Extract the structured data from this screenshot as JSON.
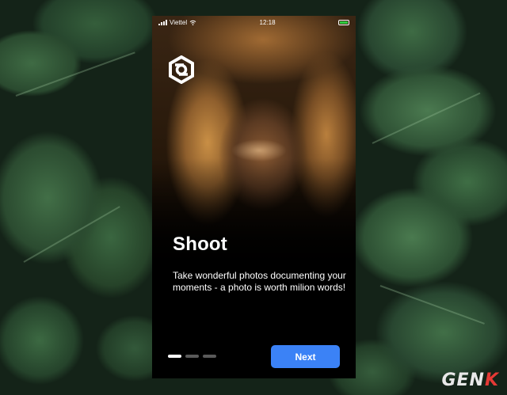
{
  "status_bar": {
    "carrier": "Viettel",
    "time": "12:18"
  },
  "app": {
    "logo_icon": "camera-hexagon-icon"
  },
  "onboarding": {
    "title": "Shoot",
    "description": "Take wonderful photos documenting your moments - a photo is worth milion words!",
    "page_count": 3,
    "current_page": 1,
    "next_label": "Next"
  },
  "watermark": {
    "prefix": "GEN",
    "accent": "K"
  },
  "colors": {
    "button": "#3b82f6",
    "page_dot_active": "#ffffff",
    "page_dot_inactive": "#5a5a5a",
    "battery": "#2ecc40",
    "watermark_accent": "#e53935"
  }
}
